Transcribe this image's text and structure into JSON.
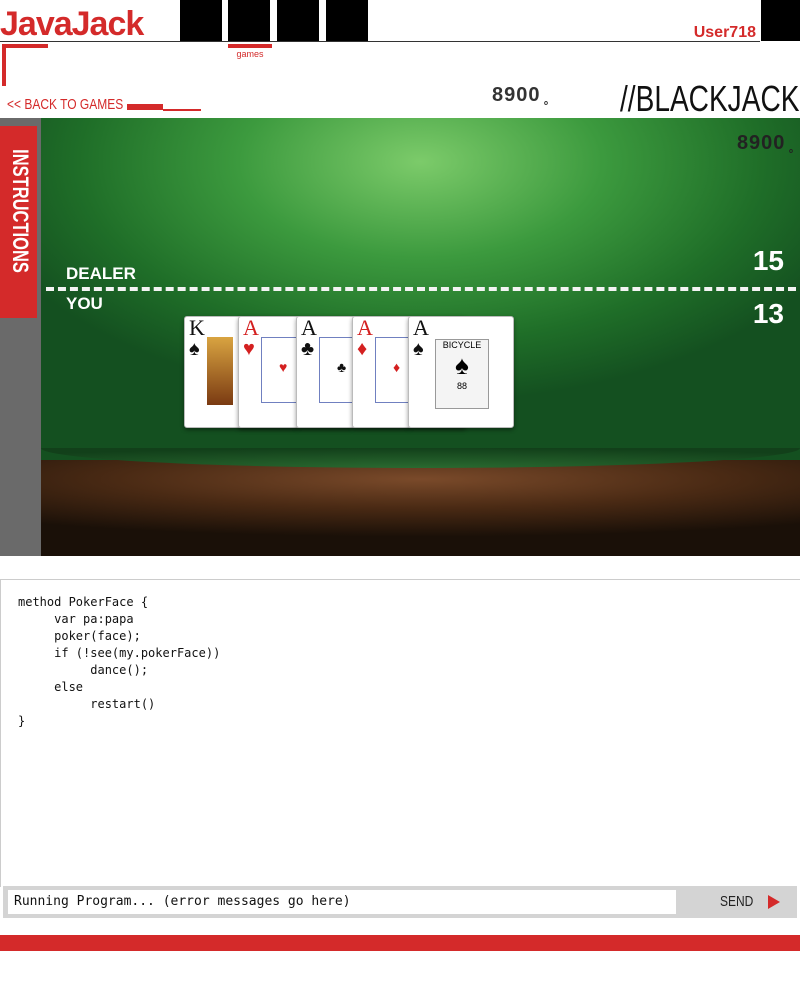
{
  "header": {
    "logo": "JavaJack",
    "games_label": "games",
    "username": "User718",
    "back_link": "<< BACK TO GAMES",
    "balance": "8900 ̥",
    "page_title": "//BLACKJACK"
  },
  "sidebar": {
    "instructions_label": "INSTRUCTIONS"
  },
  "table": {
    "balance": "8900 ̥",
    "dealer_label": "DEALER",
    "you_label": "YOU",
    "dealer_score": "15",
    "you_score": "13",
    "cards": [
      {
        "rank": "K",
        "suit": "♠",
        "color": "black"
      },
      {
        "rank": "A",
        "suit": "♥",
        "color": "red"
      },
      {
        "rank": "A",
        "suit": "♣",
        "color": "black"
      },
      {
        "rank": "A",
        "suit": "♦",
        "color": "red"
      },
      {
        "rank": "A",
        "suit": "♠",
        "color": "black"
      }
    ],
    "card_back_brand": "BICYCLE",
    "card_back_number": "88"
  },
  "editor": {
    "code": "method PokerFace {\n     var pa:papa\n     poker(face);\n     if (!see(my.pokerFace))\n          dance();\n     else\n          restart()\n}",
    "console_text": "Running Program... (error messages go here)",
    "send_label": "SEND"
  },
  "colors": {
    "accent": "#d42a2a",
    "felt": "#3c9a3e"
  }
}
